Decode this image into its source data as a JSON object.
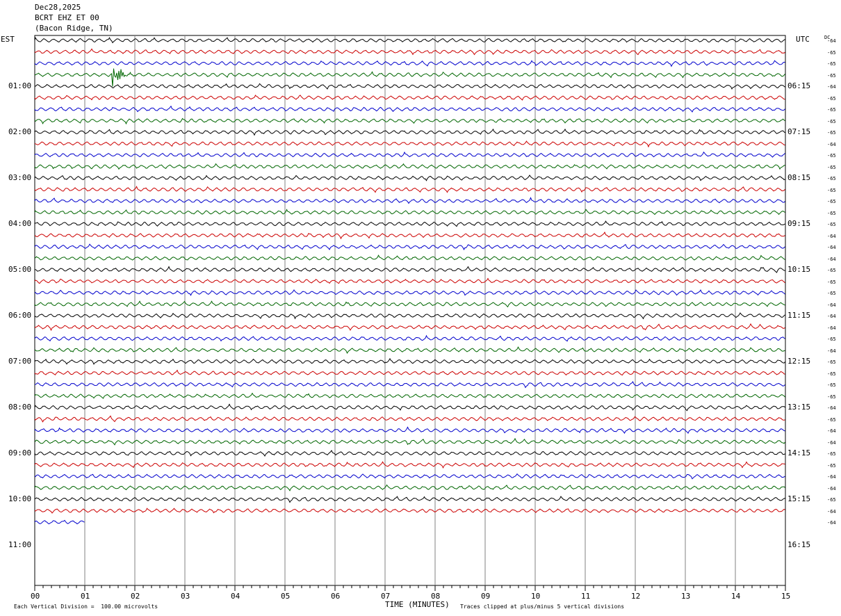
{
  "header": {
    "date": "Dec28,2025",
    "station": "BCRT EHZ ET 00",
    "location": "(Bacon Ridge, TN)"
  },
  "chart_data": {
    "type": "line",
    "title": "BCRT EHZ ET 00",
    "left_timezone_label": "EST",
    "right_timezone_label": "UTC",
    "dc_label": "DC",
    "left_hour_labels": [
      "01:00",
      "02:00",
      "03:00",
      "04:00",
      "05:00",
      "06:00",
      "07:00",
      "08:00",
      "09:00",
      "10:00",
      "11:00"
    ],
    "right_hour_labels": [
      "06:15",
      "07:15",
      "08:15",
      "09:15",
      "10:15",
      "11:15",
      "12:15",
      "13:15",
      "14:15",
      "15:15",
      "16:15"
    ],
    "x_tick_labels": [
      "00",
      "01",
      "02",
      "03",
      "04",
      "05",
      "06",
      "07",
      "08",
      "09",
      "10",
      "11",
      "12",
      "13",
      "14",
      "15"
    ],
    "xlabel": "TIME (MINUTES)",
    "xlim": [
      0,
      15
    ],
    "trace_count_total": 48,
    "trace_colors": [
      "#000000",
      "#cc0000",
      "#0000cc",
      "#006600"
    ],
    "dc_offsets": [
      "-64",
      "-65",
      "-65",
      "-65",
      "-64",
      "-65",
      "-65",
      "-65",
      "-65",
      "-64",
      "-65",
      "-65",
      "-65",
      "-65",
      "-65",
      "-65",
      "-65",
      "-64",
      "-64",
      "-64",
      "-65",
      "-65",
      "-65",
      "-64",
      "-64",
      "-64",
      "-65",
      "-64",
      "-65",
      "-65",
      "-65",
      "-65",
      "-64",
      "-65",
      "-64",
      "-64",
      "-65",
      "-65",
      "-64",
      "-64",
      "-65",
      "-64"
    ],
    "last_partial_trace_end_minute": 1.0,
    "event": {
      "trace_index": 3,
      "minute": 1.55,
      "description_shown": false
    },
    "footer_left": "Each Vertical Division =  100.00 microvolts",
    "footer_right": "Traces clipped at plus/minus 5 vertical divisions",
    "colors": {
      "grid": "#808080",
      "axis": "#000000"
    }
  }
}
